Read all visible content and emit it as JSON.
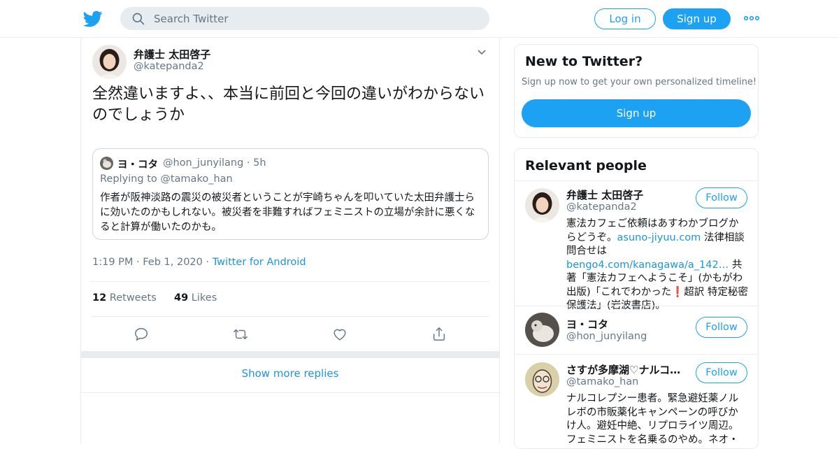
{
  "colors": {
    "accent": "#1da1f2",
    "link": "#1b95e0",
    "text": "#14171a",
    "muted": "#657786",
    "border": "#e6ecf0"
  },
  "topbar": {
    "search_placeholder": "Search Twitter",
    "login_label": "Log in",
    "signup_label": "Sign up"
  },
  "tweet": {
    "author_name": "弁護士 太田啓子",
    "author_handle": "@katepanda2",
    "text": "全然違いますよ、、本当に前回と今回の違いがわからないのでしょうか",
    "quote": {
      "name": "ヨ・コタ",
      "handle": "@hon_junyilang · 5h",
      "replying_prefix": "Replying to ",
      "replying_to": "@tamako_han",
      "text": "作者が阪神淡路の震災の被災者ということが宇崎ちゃんを叩いていた太田弁護士らに効いたのかもしれない。被災者を非難すればフェミニストの立場が余計に悪くなると計算が働いたのかも。"
    },
    "time": "1:19 PM · Feb 1, 2020 · ",
    "source": "Twitter for Android",
    "retweets_count": "12",
    "retweets_label": "Retweets",
    "likes_count": "49",
    "likes_label": "Likes"
  },
  "show_more_replies": "Show more replies",
  "new_to_twitter": {
    "title": "New to Twitter?",
    "subtitle": "Sign up now to get your own personalized timeline!",
    "button": "Sign up"
  },
  "relevant_people": {
    "title": "Relevant people",
    "follow_label": "Follow",
    "people": [
      {
        "name": "弁護士 太田啓子",
        "handle": "@katepanda2",
        "bio_1": "憲法カフェご依頼はあすわかブログからどうぞ。",
        "bio_link_1": "asuno-jiyuu.com",
        "bio_2": " 法律相談問合せは",
        "bio_link_2": "bengo4.com/kanagawa/a_142…",
        "bio_3": " 共著「憲法カフェへようこそ」(かもがわ出版)「これでわかった",
        "bio_emoji": "❗",
        "bio_4": "超訳 特定秘密保護法」(岩波書店)。"
      },
      {
        "name": "ヨ・コタ",
        "handle": "@hon_junyilang"
      },
      {
        "name": "さすが多摩湖♡ナルコ…",
        "handle": "@tamako_han",
        "bio": "ナルコレプシー患者。緊急避妊薬ノルレボの市販薬化キャンペーンの呼びかけ人。避妊中絶、リプロライツ周辺。フェミニストを名乗るのやめ。ネオ・"
      }
    ]
  }
}
